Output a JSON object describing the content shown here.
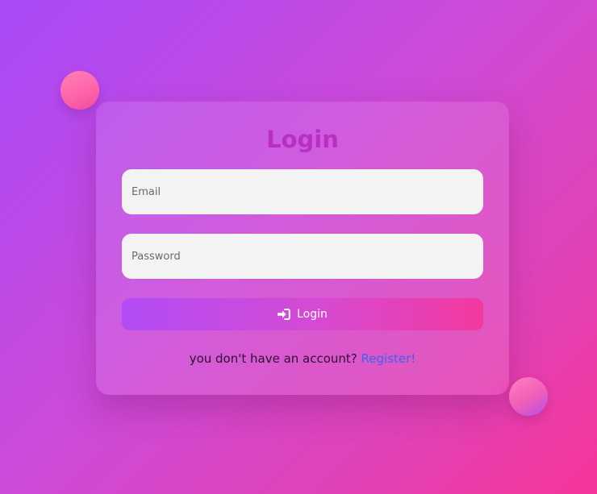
{
  "login_card": {
    "title": "Login",
    "email": {
      "placeholder": "Email",
      "value": ""
    },
    "password": {
      "placeholder": "Password",
      "value": ""
    },
    "submit_label": "Login",
    "submit_icon": "sign-in-icon",
    "footer_text": "you don't have an account? ",
    "register_link": "Register!"
  },
  "colors": {
    "title": "#b82fc2",
    "link": "#3d63f0",
    "background_start": "#a94af9",
    "background_end": "#f7359a",
    "input_background": "#f4f3f4"
  }
}
